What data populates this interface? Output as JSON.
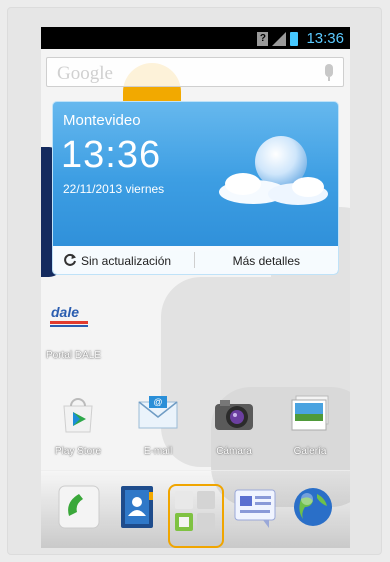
{
  "status_bar": {
    "time": "13:36",
    "icons": [
      "sim-unknown-icon",
      "signal-icon",
      "battery-icon"
    ]
  },
  "search": {
    "brand": "Google",
    "icon": "mic-icon"
  },
  "weather_widget": {
    "city": "Montevideo",
    "time": "13:36",
    "date": "22/11/2013  viernes",
    "sync_label": "Sin actualización",
    "details_label": "Más detalles",
    "icon": "partly-cloudy-icon"
  },
  "desktop_shortcuts": [
    {
      "label": "Portal DALE",
      "icon": "dale-icon",
      "logo_text": "dale"
    }
  ],
  "apps": [
    {
      "label": "Play Store",
      "icon": "play-store-icon"
    },
    {
      "label": "E-mail",
      "icon": "email-icon"
    },
    {
      "label": "Cámara",
      "icon": "camera-icon"
    },
    {
      "label": "Galería",
      "icon": "gallery-icon"
    }
  ],
  "dock": [
    {
      "name": "phone",
      "icon": "phone-icon"
    },
    {
      "name": "contacts",
      "icon": "contacts-icon"
    },
    {
      "name": "apps",
      "icon": "app-drawer-icon",
      "highlighted": true
    },
    {
      "name": "messages",
      "icon": "messages-icon"
    },
    {
      "name": "browser",
      "icon": "browser-icon"
    }
  ],
  "colors": {
    "accent_highlight": "#f0a500",
    "status_time": "#5ccaff",
    "widget_blue": "#3d9ee3"
  }
}
